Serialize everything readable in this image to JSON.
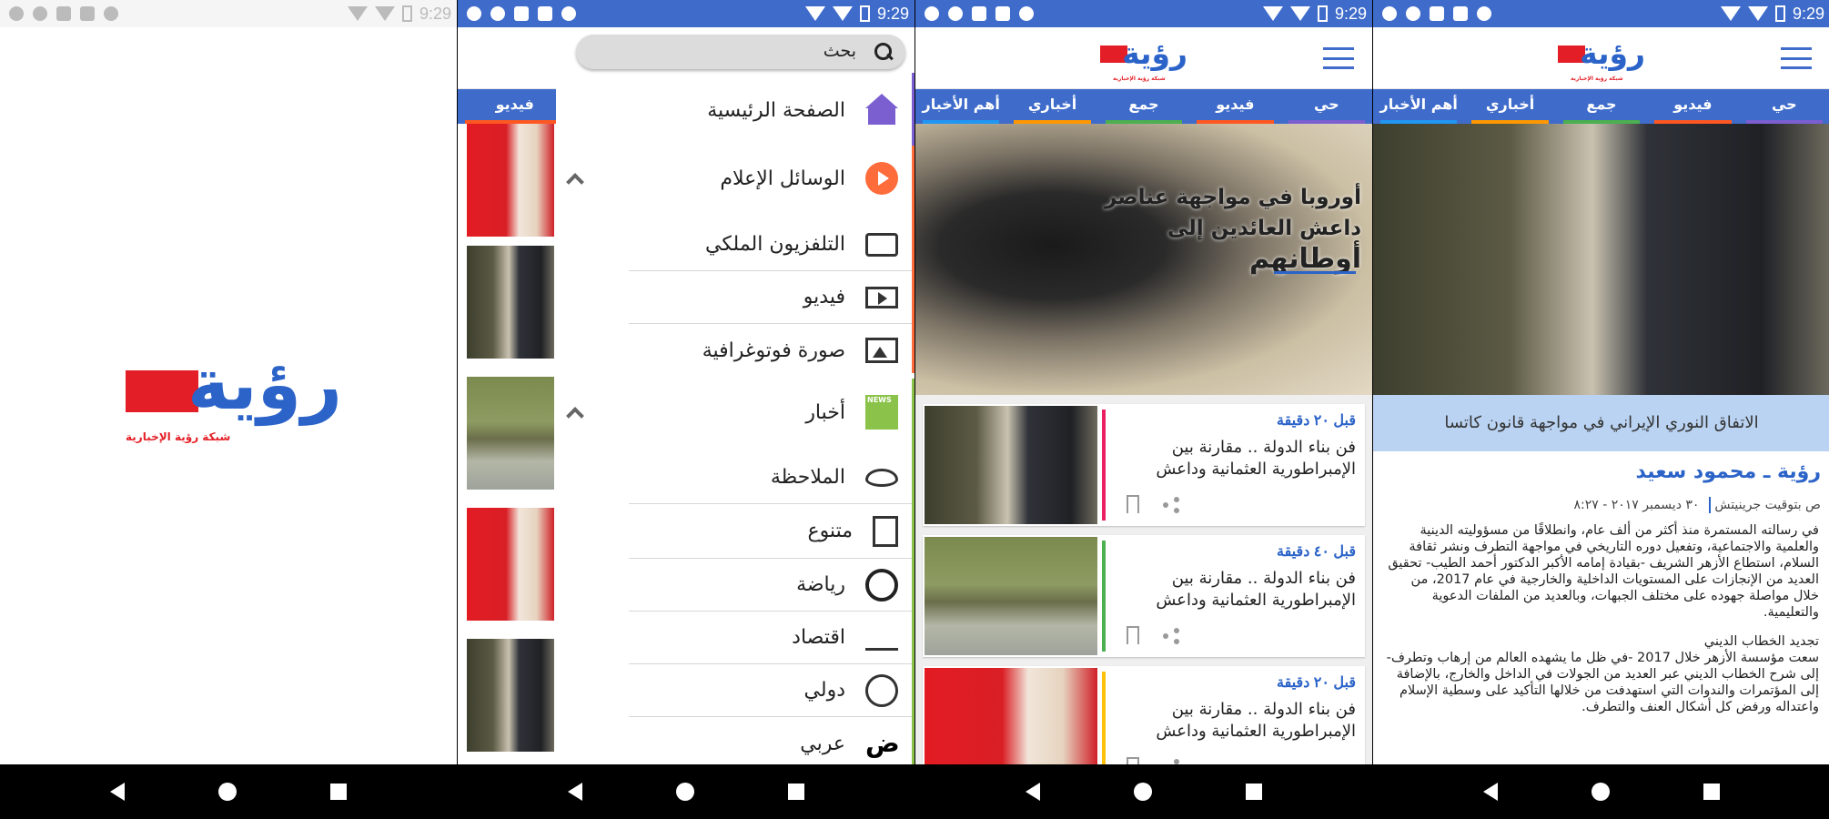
{
  "status": {
    "time": "9:29"
  },
  "brand": {
    "logo_text": "رؤية",
    "logo_sub": "شبكة رؤية الإخبارية"
  },
  "categories": [
    {
      "label": "حي",
      "color": "#7b5fd1"
    },
    {
      "label": "فيديو",
      "color": "#ff5722"
    },
    {
      "label": "جمع",
      "color": "#4caf50"
    },
    {
      "label": "أخباري",
      "color": "#ff9800"
    },
    {
      "label": "أهم الأخبار",
      "color": "#2196f3"
    }
  ],
  "drawer": {
    "search_placeholder": "بحث",
    "items": [
      {
        "label": "الصفحة الرئيسية",
        "icon": "home-icon",
        "type": "head"
      },
      {
        "label": "الوسائل الإعلام",
        "icon": "play-circle-icon",
        "type": "head",
        "expandable": true
      },
      {
        "label": "التلفزيون الملكي",
        "icon": "tv-icon",
        "type": "sub"
      },
      {
        "label": "فيديو",
        "icon": "video-icon",
        "type": "sub"
      },
      {
        "label": "صورة فوتوغرافية",
        "icon": "image-icon",
        "type": "sub"
      },
      {
        "label": "أخبار",
        "icon": "news-icon",
        "type": "head",
        "expandable": true
      },
      {
        "label": "الملاحظة",
        "icon": "eye-icon",
        "type": "sub"
      },
      {
        "label": "متنوع",
        "icon": "document-icon",
        "type": "sub"
      },
      {
        "label": "رياضة",
        "icon": "soccer-ball-icon",
        "type": "sub"
      },
      {
        "label": "اقتصاد",
        "icon": "bar-chart-icon",
        "type": "sub"
      },
      {
        "label": "دولي",
        "icon": "globe-icon",
        "type": "sub"
      },
      {
        "label": "عربي",
        "icon": "arabic-letter-icon",
        "glyph": "ض",
        "type": "sub"
      }
    ]
  },
  "hero": {
    "line1": "أوروبا في مواجهة عناصر",
    "line2": "داعش العائدين إلى",
    "line3": "أوطانهم"
  },
  "news": [
    {
      "time": "قبل ٢٠ دقيقة",
      "title": "فن بناء الدولة .. مقارنة بين الإمبراطورية العثمانية وداعش",
      "image": "men",
      "bar": "#e91e63"
    },
    {
      "time": "قبل ٤٠ دقيقة",
      "title": "فن بناء الدولة .. مقارنة بين الإمبراطورية العثمانية وداعش",
      "image": "croc",
      "bar": "#4caf50"
    },
    {
      "time": "قبل ٢٠ دقيقة",
      "title": "فن بناء الدولة .. مقارنة بين الإمبراطورية العثمانية وداعش",
      "image": "erdogan",
      "bar": "#ffc107"
    }
  ],
  "article": {
    "caption": "الاتفاق النوري الإيراني في مواجهة قانون كاتسا",
    "byline": "رؤية ـ محمود سعيد",
    "date": "٣٠ ديسمبر ٢٠١٧ - ٨:٢٧",
    "time_suffix": "ص بتوقيت جرينيتش",
    "para1": "في رسالته المستمرة منذ أكثر من ألف عام، وانطلاقًا من مسؤوليته الدينية والعلمية والاجتماعية، وتفعيل دوره التاريخي في مواجهة التطرف ونشر ثقافة السلام، استطاع الأزهر الشريف -بقيادة إمامه الأكبر الدكتور أحمد الطيب- تحقيق العديد من الإنجازات على المستويات الداخلية والخارجية في عام 2017، من خلال مواصلة جهوده على مختلف الجبهات، وبالعديد من الملفات الدعوية والتعليمية.",
    "subhead": "تجديد الخطاب الديني",
    "para2": "سعت مؤسسة الأزهر خلال 2017 -في ظل ما يشهده العالم من إرهاب وتطرف- إلى شرح الخطاب الديني عبر العديد من الجولات في الداخل والخارج، بالإضافة إلى المؤتمرات والندوات التي استهدفت من خلالها التأكيد على وسطية الإسلام واعتداله ورفض كل أشكال العنف والتطرف."
  }
}
